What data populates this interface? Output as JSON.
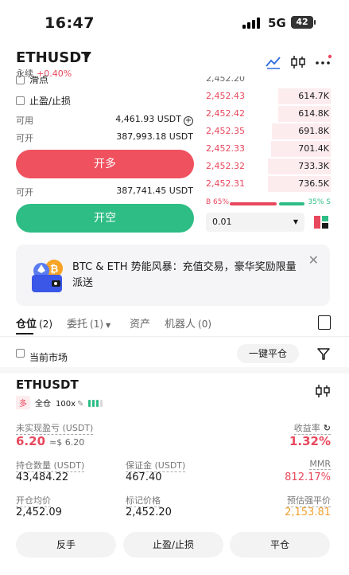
{
  "status_bar": {
    "time": "16:47",
    "network": "5G",
    "battery": "42"
  },
  "header": {
    "pair": "ETHUSDT",
    "contract_type": "永续",
    "change": "+0.40%",
    "icons": [
      "chart-line-icon",
      "candlestick-icon",
      "more-icon"
    ]
  },
  "form": {
    "partial_label": "滑点",
    "tp_sl_label": "止盈/止损",
    "available_label": "可用",
    "available_value": "4,461.93 USDT",
    "can_open_label": "可开",
    "can_open_value_long": "387,993.18 USDT",
    "buy_label": "开多",
    "can_open_value_short": "387,741.45 USDT",
    "sell_label": "开空"
  },
  "orderbook": {
    "partial_price": "2,452.20",
    "asks": [
      {
        "price": "2,452.43",
        "qty": "614.7K",
        "depth": 0.42
      },
      {
        "price": "2,452.42",
        "qty": "614.8K",
        "depth": 0.42
      },
      {
        "price": "2,452.35",
        "qty": "691.8K",
        "depth": 0.47
      },
      {
        "price": "2,452.33",
        "qty": "701.4K",
        "depth": 0.48
      },
      {
        "price": "2,452.32",
        "qty": "733.3K",
        "depth": 0.5
      },
      {
        "price": "2,452.31",
        "qty": "736.5K",
        "depth": 0.5
      }
    ],
    "buy_ratio_label": "B 65%",
    "sell_ratio_label": "35% S",
    "buy_ratio": 65,
    "precision": "0.01"
  },
  "banner": {
    "text": "BTC & ETH 势能风暴：充值交易，豪华奖励限量派送"
  },
  "tabs": [
    {
      "label": "仓位",
      "count": "(2)"
    },
    {
      "label": "委托",
      "count": "(1)"
    },
    {
      "label": "资产",
      "count": ""
    },
    {
      "label": "机器人",
      "count": "(0)"
    }
  ],
  "filter": {
    "current_market_label": "当前市场",
    "close_all_label": "一键平仓"
  },
  "position": {
    "symbol": "ETHUSDT",
    "side": "多",
    "margin_mode": "全仓",
    "leverage": "100x",
    "unrealized_label": "未实现盈亏 (USDT)",
    "unrealized_value": "6.20",
    "unrealized_fiat": "≈$ 6.20",
    "roe_label": "收益率",
    "roe_value": "1.32%",
    "size_label": "持仓数量 (USDT)",
    "size_value": "43,484.22",
    "margin_label": "保证金 (USDT)",
    "margin_value": "467.40",
    "mmr_label": "MMR",
    "mmr_value": "812.17%",
    "entry_label": "开仓均价",
    "entry_value": "2,452.09",
    "mark_label": "标记价格",
    "mark_value": "2,452.20",
    "liq_label": "预估强平价",
    "liq_value": "2,153.81"
  },
  "actions": {
    "reverse": "反手",
    "tp_sl": "止盈/止损",
    "close": "平仓"
  },
  "colors": {
    "buy": "#f0515f",
    "sell": "#2ebd85",
    "warn": "#f0a030"
  }
}
